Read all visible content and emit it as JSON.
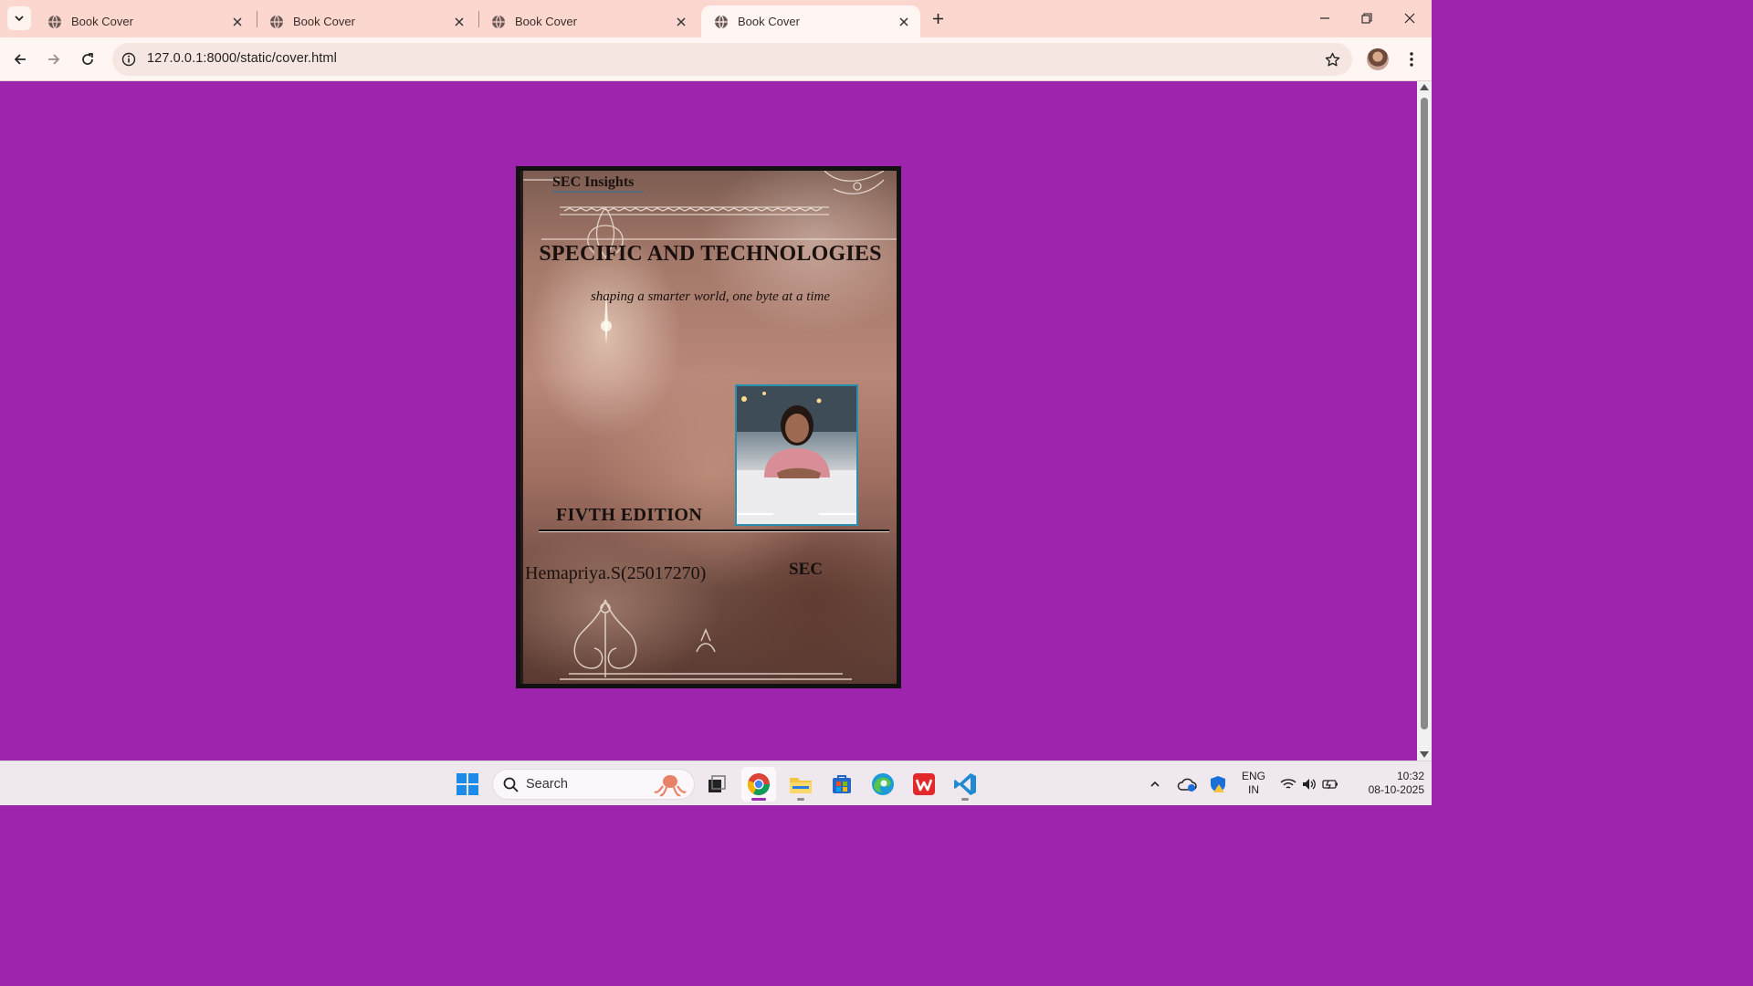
{
  "browser": {
    "tabs": [
      {
        "title": "Book Cover",
        "active": false
      },
      {
        "title": "Book Cover",
        "active": false
      },
      {
        "title": "Book Cover",
        "active": false
      },
      {
        "title": "Book Cover",
        "active": true
      }
    ],
    "url": "127.0.0.1:8000/static/cover.html"
  },
  "cover": {
    "publisher": "SEC Insights",
    "title": "SPECIFIC AND TECHNOLOGIES",
    "tagline": "shaping a smarter world, one byte at a time",
    "edition": "FIVTH EDITION",
    "author": "Hemapriya.S(25017270)",
    "organization": "SEC"
  },
  "taskbar": {
    "search_label": "Search",
    "language_line1": "ENG",
    "language_line2": "IN",
    "time": "10:32",
    "date": "08-10-2025"
  },
  "colors": {
    "page_background": "#9d24ad",
    "tab_strip": "#fcd7cf",
    "toolbar": "#fff5f2",
    "photo_border": "#2b8fae"
  }
}
